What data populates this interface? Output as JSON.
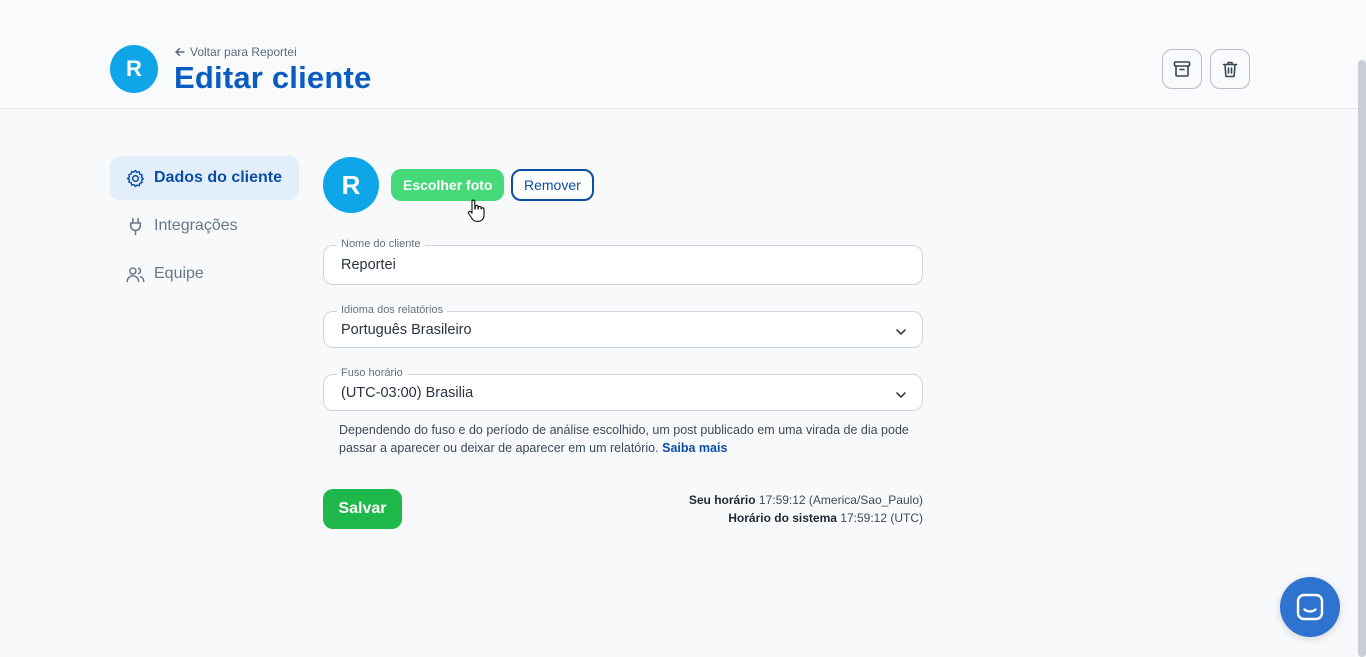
{
  "header": {
    "avatar_letter": "R",
    "back_link": "Voltar para Reportei",
    "title": "Editar cliente",
    "archive_icon": "archive-icon",
    "trash_icon": "trash-icon"
  },
  "sidebar": {
    "items": [
      {
        "label": "Dados do cliente",
        "icon": "gear-icon",
        "active": true
      },
      {
        "label": "Integrações",
        "icon": "plug-icon",
        "active": false
      },
      {
        "label": "Equipe",
        "icon": "users-icon",
        "active": false
      }
    ]
  },
  "photo": {
    "avatar_letter": "R",
    "choose_label": "Escolher foto",
    "remove_label": "Remover"
  },
  "form": {
    "client_name": {
      "label": "Nome do cliente",
      "value": "Reportei"
    },
    "report_language": {
      "label": "Idioma dos relatórios",
      "value": "Português Brasileiro"
    },
    "timezone": {
      "label": "Fuso horário",
      "value": "(UTC-03:00) Brasilia"
    },
    "help_text": "Dependendo do fuso e do período de análise escolhido, um post publicado em uma virada de dia pode passar a aparecer ou deixar de aparecer em um relatório.",
    "help_link": "Saiba mais",
    "save_label": "Salvar"
  },
  "times": {
    "user_label": "Seu horário",
    "user_value": "17:59:12 (America/Sao_Paulo)",
    "system_label": "Horário do sistema",
    "system_value": "17:59:12 (UTC)"
  },
  "colors": {
    "brand_blue": "#0b5cc0",
    "avatar": "#0ea5e9",
    "choose_green": "#46d97a",
    "save_green": "#1fb84a",
    "chat_blue": "#2f73d0"
  }
}
